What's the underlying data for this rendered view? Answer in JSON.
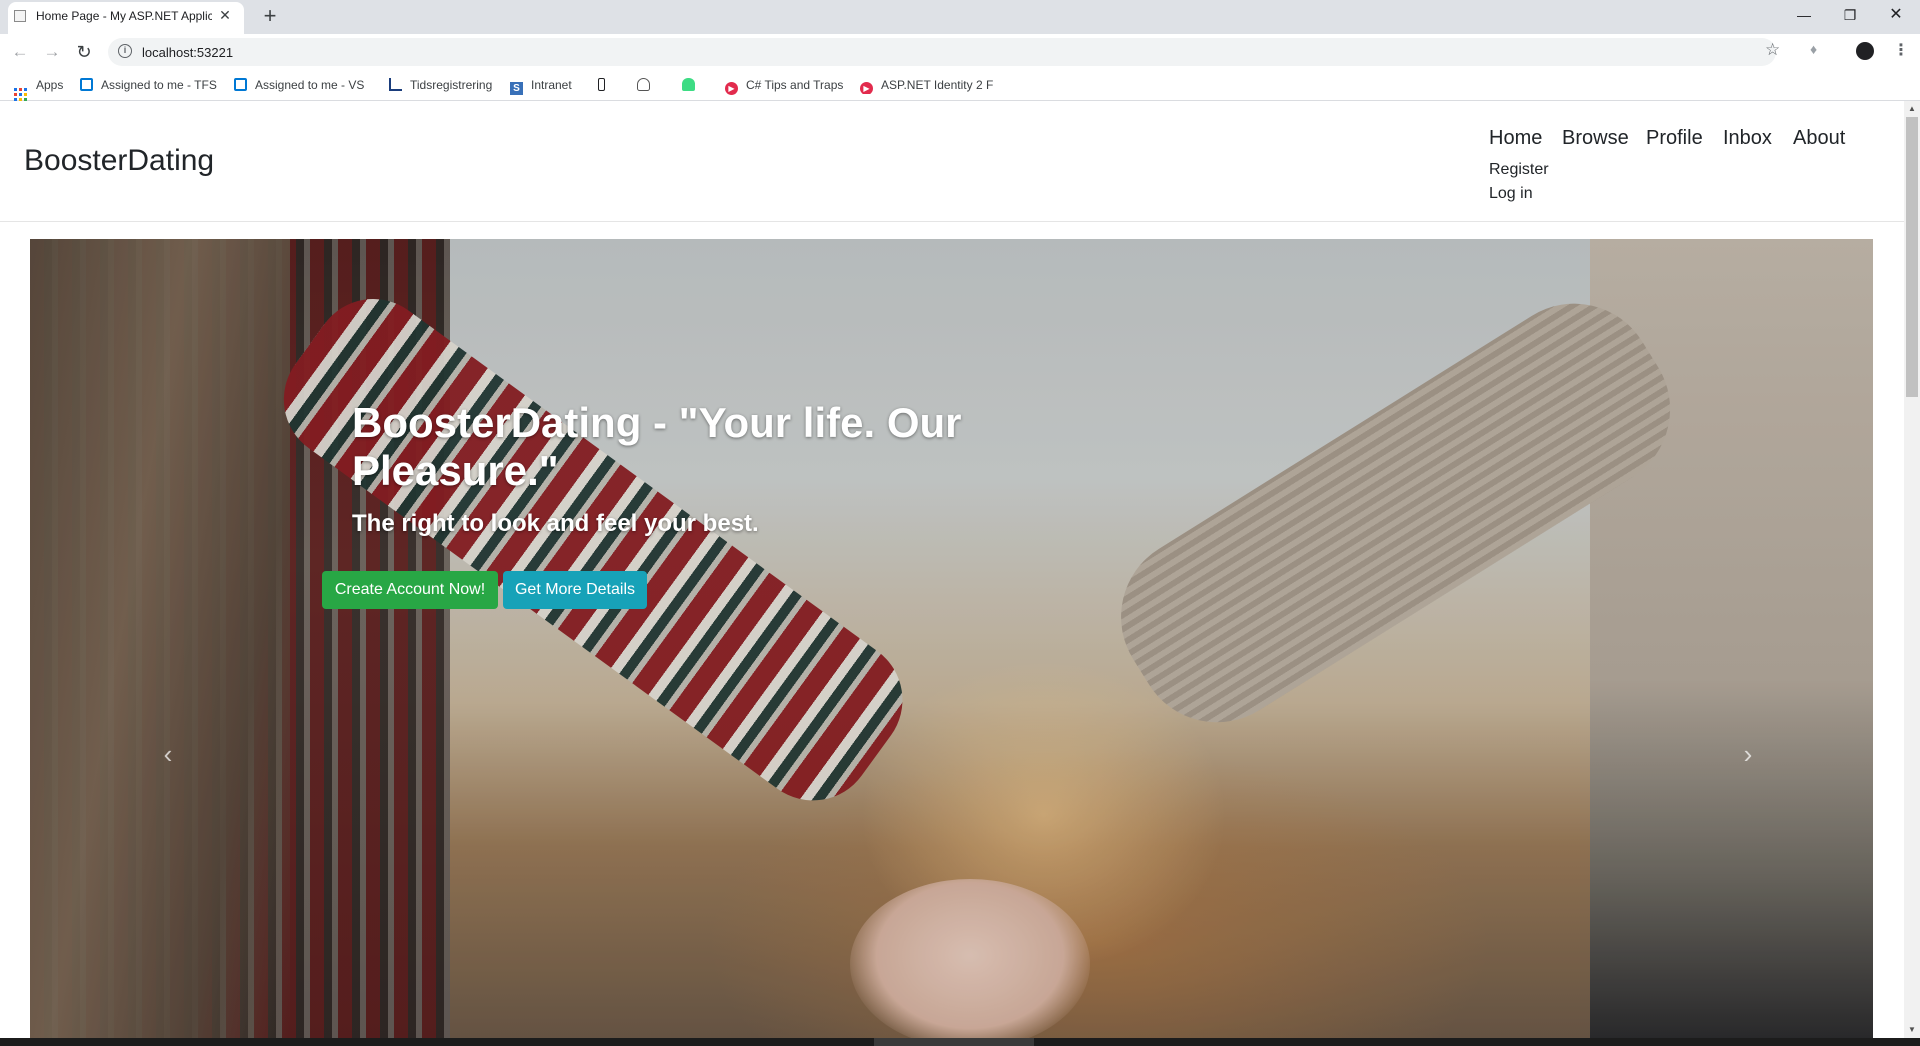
{
  "browser": {
    "tab_title": "Home Page - My ASP.NET Applic",
    "tab_close": "✕",
    "new_tab": "+",
    "window_controls": {
      "minimize": "—",
      "restore": "❐",
      "close": "✕"
    },
    "url": "localhost:53221",
    "icons": {
      "back": "back-arrow-icon",
      "forward": "forward-arrow-icon",
      "reload": "reload-icon",
      "info": "info-icon",
      "star": "bookmark-star-icon",
      "extension": "extension-icon",
      "profile": "profile-avatar-icon",
      "menu": "more-menu-icon"
    },
    "glyphs": {
      "back": "←",
      "forward": "→",
      "reload": "↻",
      "info": "i",
      "star": "☆",
      "extension": "♦",
      "menu": "⋮"
    },
    "bookmarks": [
      {
        "label": "Apps",
        "icon": "apps-grid-icon"
      },
      {
        "label": "Assigned to me - TFS",
        "icon": "vsts-icon"
      },
      {
        "label": "Assigned to me - VS",
        "icon": "vsts-icon"
      },
      {
        "label": "Tidsregistrering",
        "icon": "chart-icon"
      },
      {
        "label": "Intranet",
        "icon": "sharepoint-icon"
      },
      {
        "label": "",
        "icon": "phone-icon"
      },
      {
        "label": "",
        "icon": "graduation-cap-icon"
      },
      {
        "label": "",
        "icon": "android-icon"
      },
      {
        "label": "C# Tips and Traps",
        "icon": "pluralsight-icon"
      },
      {
        "label": "ASP.NET Identity 2 F",
        "icon": "pluralsight-icon"
      }
    ]
  },
  "site": {
    "brand": "BoosterDating",
    "nav": [
      "Home",
      "Browse",
      "Profile",
      "Inbox",
      "About"
    ],
    "auth": {
      "register": "Register",
      "login": "Log in"
    },
    "hero": {
      "title": "BoosterDating - \"Your life. Our Pleasure.\"",
      "subtitle": "The right to look and feel your best.",
      "primary_button": "Create Account Now!",
      "secondary_button": "Get More Details",
      "prev_glyph": "‹",
      "next_glyph": "›"
    }
  },
  "colors": {
    "primary_button": "#28a745",
    "secondary_button": "#17a2b8",
    "tabstrip": "#dee1e6"
  }
}
